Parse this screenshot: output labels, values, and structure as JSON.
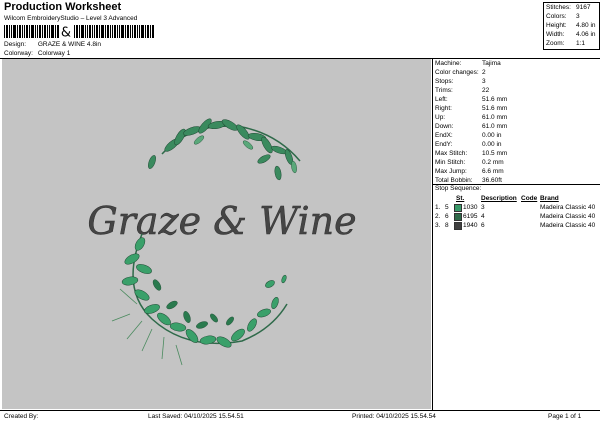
{
  "header": {
    "title": "Production Worksheet",
    "subtitle": "Wilcom EmbroideryStudio – Level 3 Advanced",
    "design_label": "Design:",
    "design_value": "GRAZE & WINE 4.8in",
    "colorway_label": "Colorway:",
    "colorway_value": "Colorway 1"
  },
  "stats": [
    {
      "label": "Stitches:",
      "value": "9167"
    },
    {
      "label": "Colors:",
      "value": "3"
    },
    {
      "label": "Height:",
      "value": "4.80 in"
    },
    {
      "label": "Width:",
      "value": "4.06 in"
    },
    {
      "label": "Zoom:",
      "value": "1:1"
    }
  ],
  "machine_info": [
    {
      "label": "Machine:",
      "value": "Tajima"
    },
    {
      "label": "Color changes:",
      "value": "2"
    },
    {
      "label": "Stops:",
      "value": "3"
    },
    {
      "label": "Trims:",
      "value": "22"
    },
    {
      "label": "Left:",
      "value": "51.6 mm"
    },
    {
      "label": "Right:",
      "value": "51.6 mm"
    },
    {
      "label": "Up:",
      "value": "61.0 mm"
    },
    {
      "label": "Down:",
      "value": "61.0 mm"
    },
    {
      "label": "EndX:",
      "value": "0.00 in"
    },
    {
      "label": "EndY:",
      "value": "0.00 in"
    },
    {
      "label": "Max Stitch:",
      "value": "10.5 mm"
    },
    {
      "label": "Min Stitch:",
      "value": "0.2 mm"
    },
    {
      "label": "Max Jump:",
      "value": "6.6 mm"
    },
    {
      "label": "Total Bobbin:",
      "value": "36.60ft"
    }
  ],
  "stop_sequence": {
    "title": "Stop Sequence:",
    "headers": {
      "st": "St.",
      "description": "Description",
      "code": "Code",
      "brand": "Brand"
    },
    "rows": [
      {
        "index": "1.",
        "n": "5",
        "code": "1030",
        "st": "3",
        "brand": "Madeira Classic 40",
        "color": "#3a9a6a"
      },
      {
        "index": "2.",
        "n": "6",
        "code": "6195",
        "st": "4",
        "brand": "Madeira Classic 40",
        "color": "#2f6a4a"
      },
      {
        "index": "3.",
        "n": "8",
        "code": "1940",
        "st": "6",
        "brand": "Madeira Classic 40",
        "color": "#404040"
      }
    ]
  },
  "design_text": "Graze & Wine",
  "colors": {
    "canvas": "#c4c4c4",
    "leaf_light": "#3a9a6a",
    "leaf_dark": "#2f6a4a",
    "text": "#404040"
  },
  "footer": {
    "created_by": "Created By:",
    "last_saved": "Last Saved: 04/10/2025 15.54.51",
    "printed": "Printed: 04/10/2025 15.54.54",
    "page": "Page 1 of 1"
  }
}
